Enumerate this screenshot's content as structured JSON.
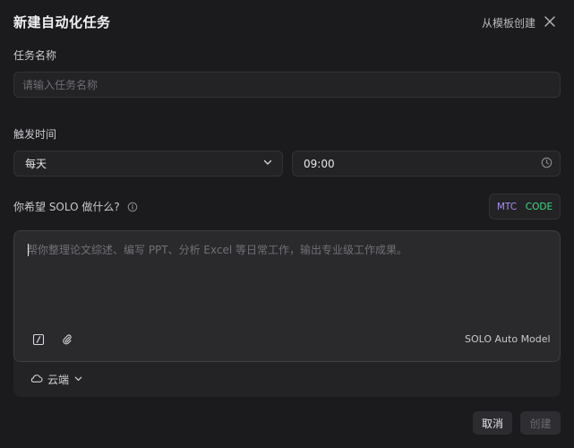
{
  "dialog": {
    "title": "新建自动化任务",
    "template_link": "从模板创建",
    "close_icon": "close-icon"
  },
  "task_name": {
    "label": "任务名称",
    "value": "",
    "placeholder": "请输入任务名称"
  },
  "trigger": {
    "label": "触发时间",
    "frequency": "每天",
    "frequency_icon": "chevron-down-icon",
    "time": "09:00",
    "time_icon": "clock-icon"
  },
  "prompt": {
    "label": "你希望 SOLO 做什么?",
    "info_icon": "info-icon",
    "modes": [
      "MTC",
      "CODE"
    ],
    "value": "",
    "placeholder": "帮你整理论文综述、编写 PPT、分析 Excel 等日常工作，输出专业级工作成果。",
    "tools": [
      "slash-command-icon",
      "paperclip-icon"
    ],
    "model": "SOLO Auto Model"
  },
  "environment": {
    "icon": "cloud-icon",
    "label": "云端",
    "dropdown_icon": "chevron-down-icon"
  },
  "footer": {
    "cancel": "取消",
    "create": "创建"
  },
  "colors": {
    "background": "#1b1b1e",
    "field": "#232326",
    "mtc": "#a98cf5",
    "code": "#3ddc84"
  }
}
